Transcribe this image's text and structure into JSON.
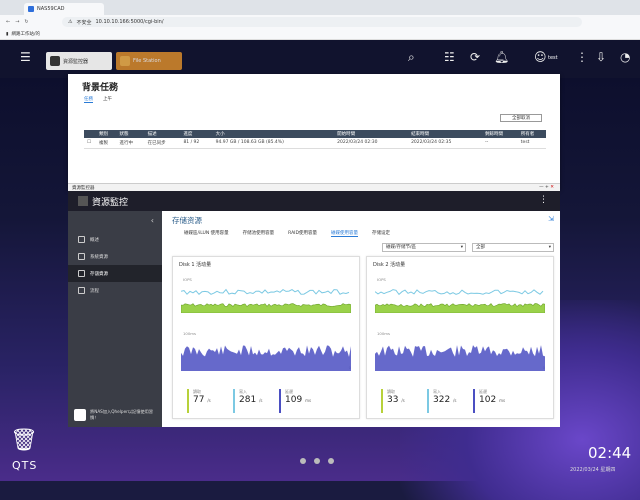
{
  "browser": {
    "tab_title": "NAS59CAD",
    "insecure": "不安全",
    "url": "10.10.10.166:5000/cgi-bin/",
    "bookmark": "網路工作站/的"
  },
  "taskbar": {
    "app1": "資源監控器",
    "app2": "File Station",
    "user": "test",
    "badge1": "1",
    "badge2": "1",
    "badge3": "10+",
    "badge4": "1"
  },
  "bg": {
    "title": "背景任務",
    "tabs": [
      "任務",
      "上午"
    ],
    "button": "全部取消",
    "headers": [
      "",
      "類別",
      "狀態",
      "描述",
      "進度",
      "大小",
      "開始時間",
      "結束時間",
      "剩餘時間",
      "所有者"
    ],
    "row": [
      "",
      "複製",
      "進行中",
      "在已同步",
      "81 / 92",
      "94.97 GB / 108.63 GB (85.4%)",
      "2022/03/24 02:30",
      "2022/03/24 02:35",
      "--",
      "test"
    ]
  },
  "rm": {
    "bar_title": "資源監控器",
    "title": "資源監控",
    "menu": [
      "概述",
      "系統資源",
      "存儲資源",
      "流程"
    ],
    "footer": "將NAS加入Qhelper以記憶使用習慣！",
    "heading": "存储资源",
    "tabs": [
      "磁碟區/iLUN 使用容量",
      "存储池使用容量",
      "RAID使用容量",
      "磁碟使用容量",
      "存储设定"
    ],
    "select1": "磁碟/存储节/區",
    "select2": "全部",
    "disks": [
      {
        "title": "Disk 1 活动量",
        "iops": "IOPS",
        "ms": "100ms",
        "zero": "0",
        "zero_ms": "0",
        "v1": "77",
        "u1": "/s",
        "v2": "281",
        "u2": "/s",
        "v3": "109",
        "u3": "ms",
        "k1": "讀取",
        "k2": "寫入",
        "k3": "延遲"
      },
      {
        "title": "Disk 2 活动量",
        "iops": "IOPS",
        "ms": "100ms",
        "zero": "0",
        "zero_ms": "0",
        "v1": "33",
        "u1": "/s",
        "v2": "322",
        "u2": "/s",
        "v3": "102",
        "u3": "ms",
        "k1": "讀取",
        "k2": "寫入",
        "k3": "延遲"
      }
    ]
  },
  "dock": {
    "qts": "QTS",
    "time": "02:44",
    "date": "2022/03/24 星期四"
  }
}
